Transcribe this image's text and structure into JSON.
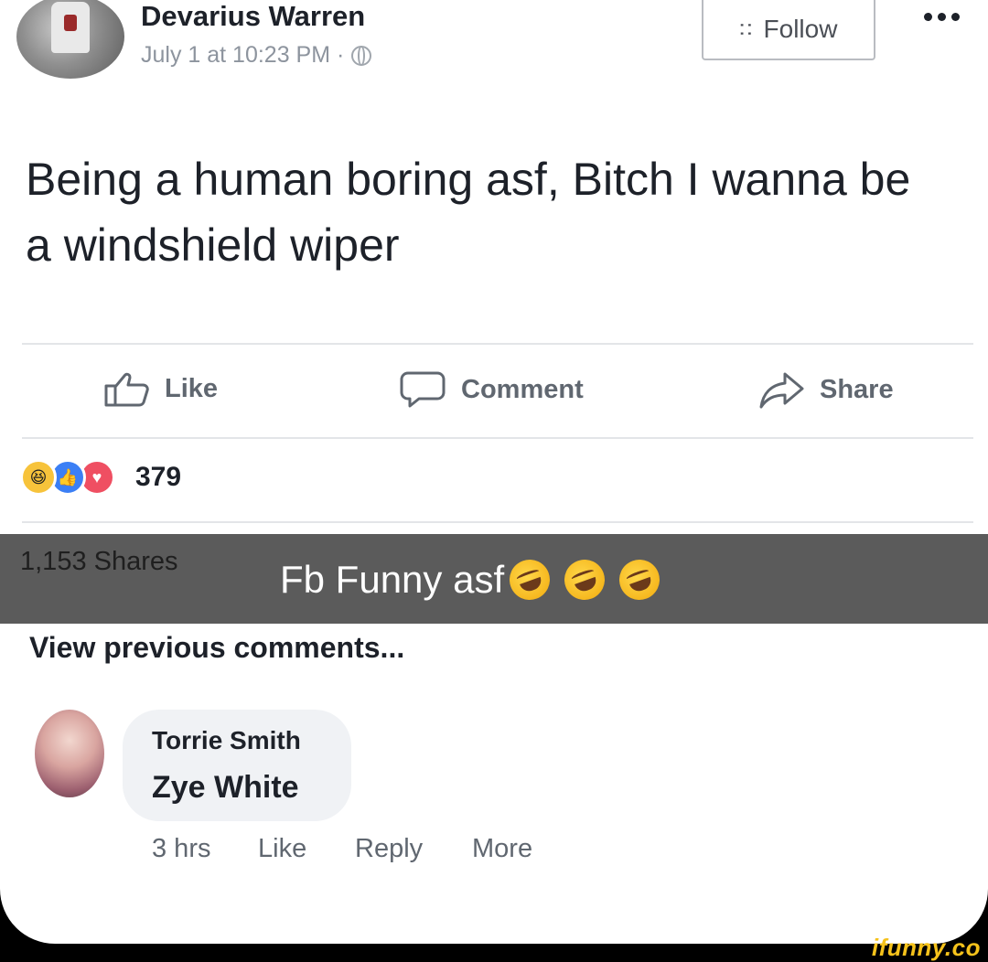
{
  "post": {
    "author": "Devarius Warren",
    "timestamp": "July 1 at 10:23 PM ·",
    "privacy_icon": "globe-icon",
    "follow_label": "Follow",
    "text": "Being a human boring asf, Bitch I wanna be a windshield wiper"
  },
  "actions": {
    "like_label": "Like",
    "comment_label": "Comment",
    "share_label": "Share"
  },
  "reactions": {
    "icons": [
      "haha-reaction-icon",
      "like-reaction-icon",
      "love-reaction-icon"
    ],
    "count": "379"
  },
  "shares": "1,153 Shares",
  "caption": "Fb Funny asf",
  "caption_emojis": [
    "rofl-emoji",
    "rofl-emoji",
    "rofl-emoji"
  ],
  "comments_section": {
    "view_previous": "View previous comments...",
    "comment": {
      "author": "Torrie Smith",
      "text": "Zye White",
      "time": "3 hrs",
      "like_label": "Like",
      "reply_label": "Reply",
      "more_label": "More"
    }
  },
  "watermark": "ifunny.co",
  "colors": {
    "banner": "#5b5b5b",
    "muted_text": "#606770",
    "watermark": "#f5c21b"
  }
}
